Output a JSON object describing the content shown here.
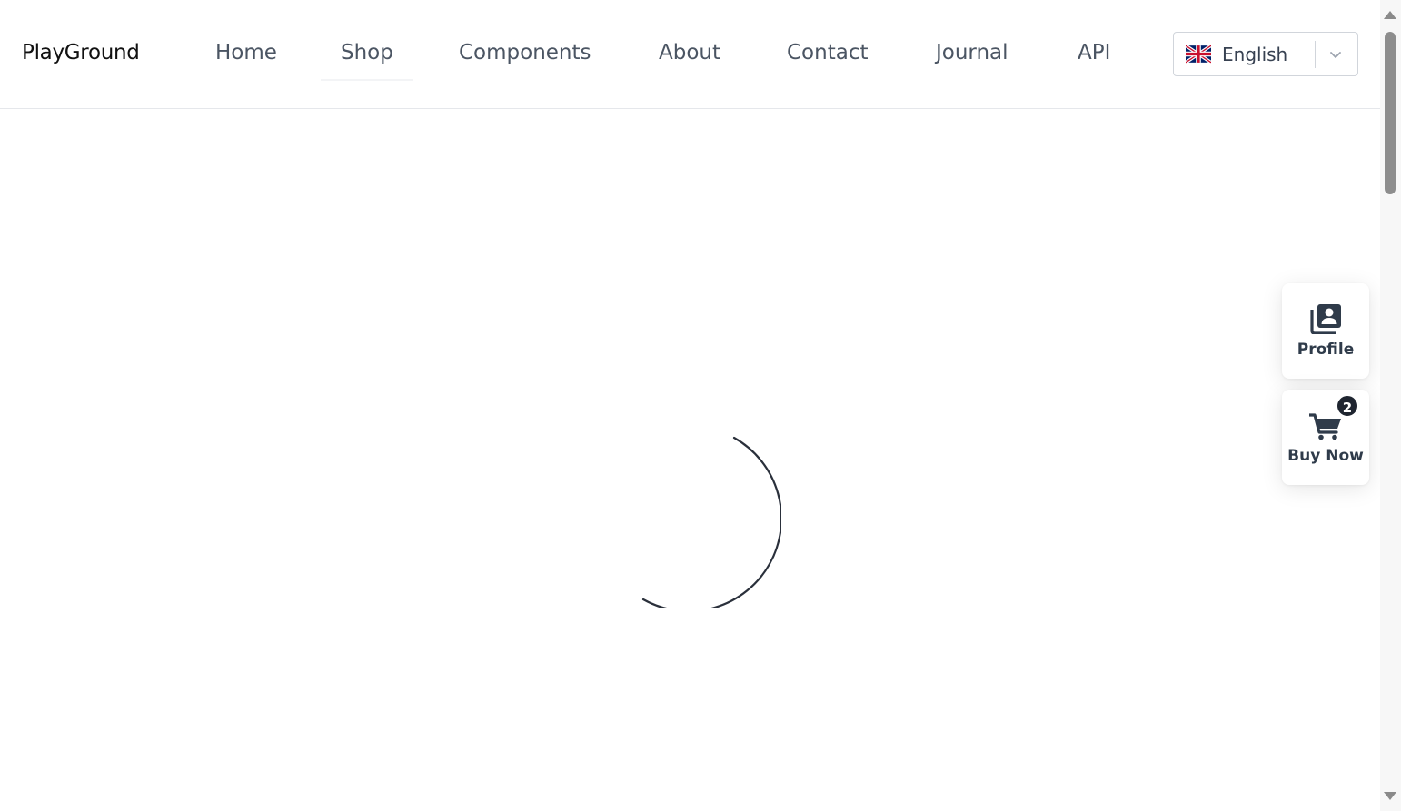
{
  "header": {
    "brand": "PlayGround",
    "nav": [
      {
        "label": "Home",
        "active": false
      },
      {
        "label": "Shop",
        "active": true
      },
      {
        "label": "Components",
        "active": false
      },
      {
        "label": "About",
        "active": false
      },
      {
        "label": "Contact",
        "active": false
      },
      {
        "label": "Journal",
        "active": false
      },
      {
        "label": "API",
        "active": false
      }
    ],
    "language": {
      "selected": "English",
      "flag_icon": "uk-flag-icon",
      "chevron_icon": "chevron-down-icon"
    }
  },
  "main": {
    "loading": true,
    "spinner_color": "#1f2530"
  },
  "floating_actions": {
    "profile": {
      "label": "Profile",
      "icon": "profile-card-icon"
    },
    "cart": {
      "label": "Buy Now",
      "icon": "cart-icon",
      "badge_count": "2"
    }
  },
  "colors": {
    "text": "#4b5563",
    "brand_text": "#111111",
    "card_text": "#2f3b4a",
    "badge_bg": "#1f2530"
  }
}
